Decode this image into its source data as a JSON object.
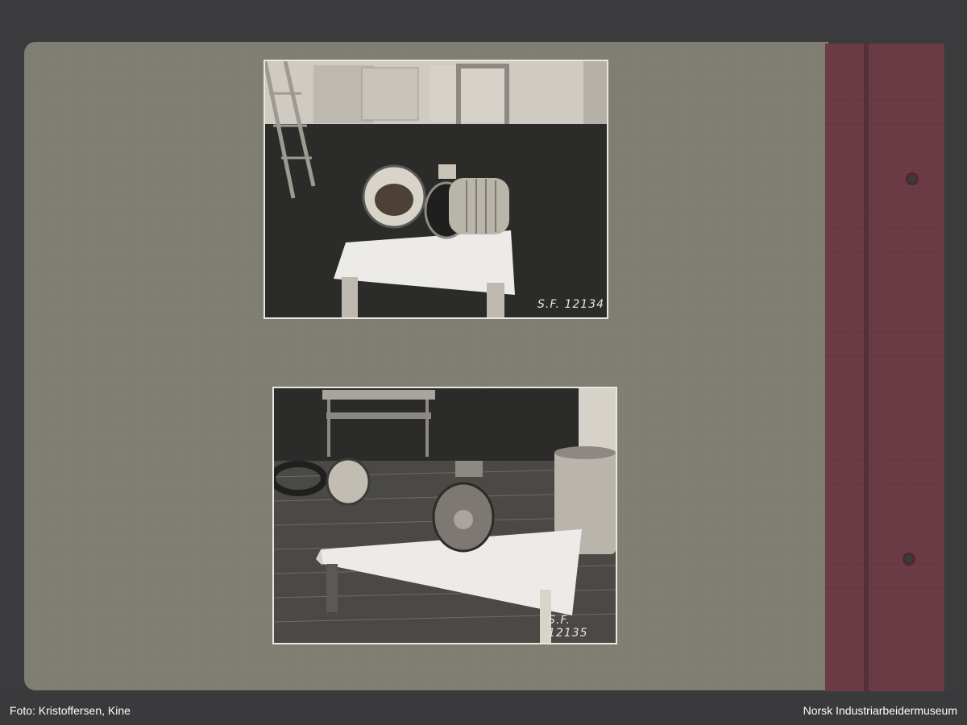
{
  "photos": [
    {
      "id_label": "S.F. 12134"
    },
    {
      "id_label_line1": "S.F.",
      "id_label_line2": "12135"
    }
  ],
  "footer": {
    "credit": "Foto: Kristoffersen, Kine",
    "institution": "Norsk Industriarbeidermuseum"
  }
}
